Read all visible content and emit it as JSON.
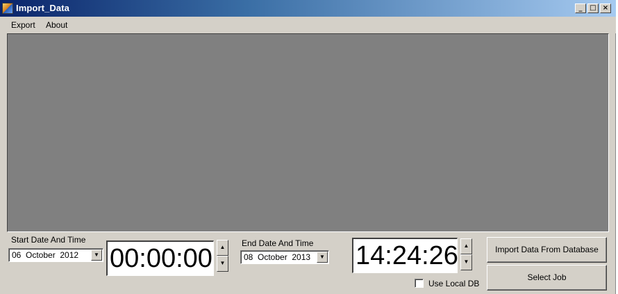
{
  "window": {
    "title": "Import_Data",
    "buttons": {
      "minimize": "_",
      "maximize": "□",
      "close": "×"
    }
  },
  "menu": {
    "items": [
      {
        "label": "Export"
      },
      {
        "label": "About"
      }
    ]
  },
  "start": {
    "label": "Start Date And Time",
    "date": "06  October  2012",
    "time": "00:00:00"
  },
  "end": {
    "label": "End Date And Time",
    "date": "08  October  2013",
    "time": "14:24:26"
  },
  "actions": {
    "import_label": "Import Data From Database",
    "select_job_label": "Select Job"
  },
  "options": {
    "use_local_db_label": "Use Local DB",
    "use_local_db_checked": false
  },
  "glyphs": {
    "dropdown": "▼",
    "spin_up": "▲",
    "spin_down": "▼"
  },
  "colors": {
    "title_gradient_start": "#0a246a",
    "title_gradient_end": "#a6caf0",
    "panel": "#808080",
    "control_face": "#d4d0c8"
  }
}
